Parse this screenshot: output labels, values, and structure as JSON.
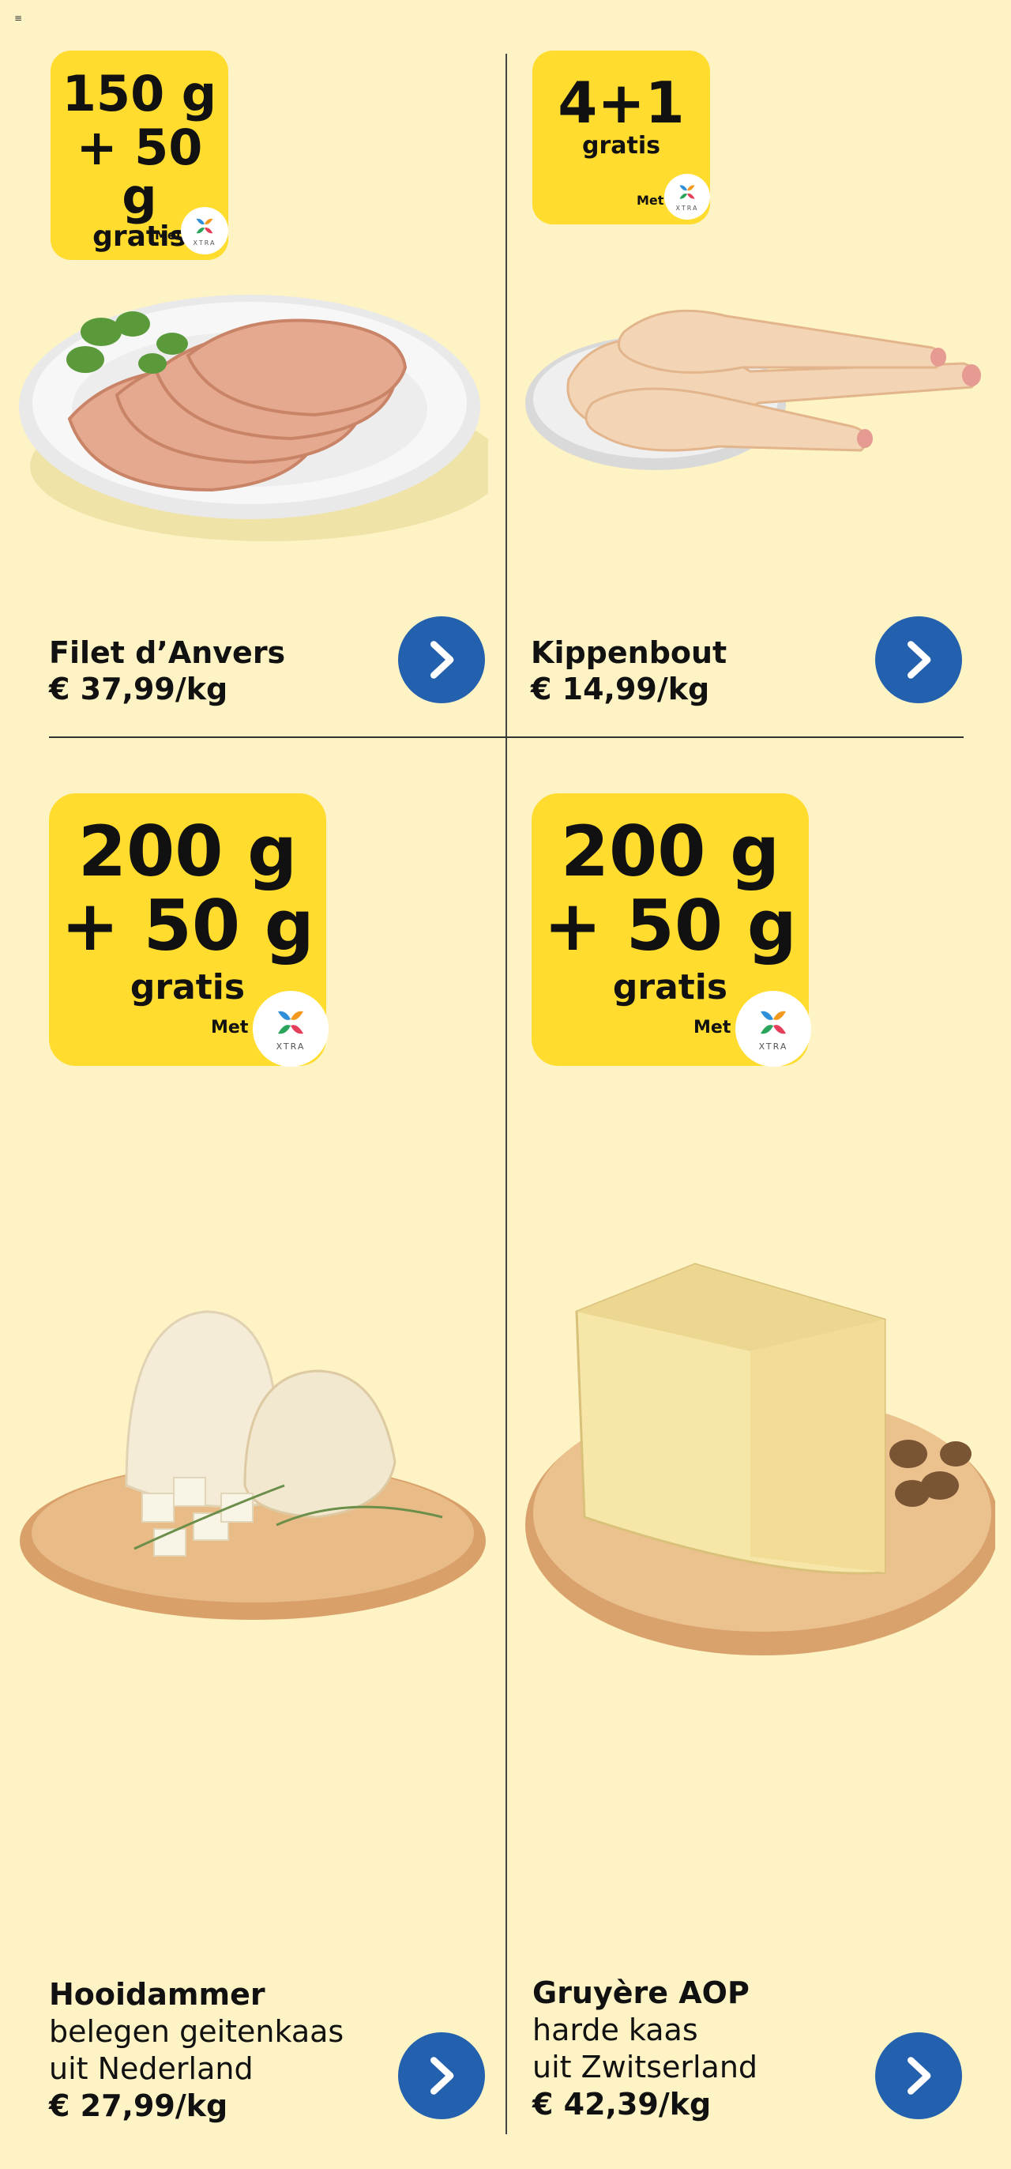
{
  "menu_glyph": "≡",
  "products": [
    {
      "badge": [
        "150 g",
        "+ 50 g",
        "gratis"
      ],
      "met": "Met",
      "xtra": "XTRA",
      "name": "Filet d’Anvers",
      "desc": [],
      "price": "€ 37,99/kg"
    },
    {
      "badge": [
        "4+1",
        "gratis"
      ],
      "met": "Met",
      "xtra": "XTRA",
      "name": "Kippenbout",
      "desc": [],
      "price": "€ 14,99/kg"
    },
    {
      "badge": [
        "200 g",
        "+ 50 g",
        "gratis"
      ],
      "met": "Met",
      "xtra": "XTRA",
      "name": "Hooidammer",
      "desc": [
        "belegen geitenkaas",
        "uit Nederland"
      ],
      "price": "€ 27,99/kg"
    },
    {
      "badge": [
        "200 g",
        "+ 50 g",
        "gratis"
      ],
      "met": "Met",
      "xtra": "XTRA",
      "name": "Gruyère AOP",
      "desc": [
        "harde kaas",
        "uit Zwitserland"
      ],
      "price": "€ 42,39/kg"
    }
  ],
  "colors": {
    "background": "#fdf3c4",
    "badge": "#ffdc2e",
    "button": "#2360ad"
  }
}
